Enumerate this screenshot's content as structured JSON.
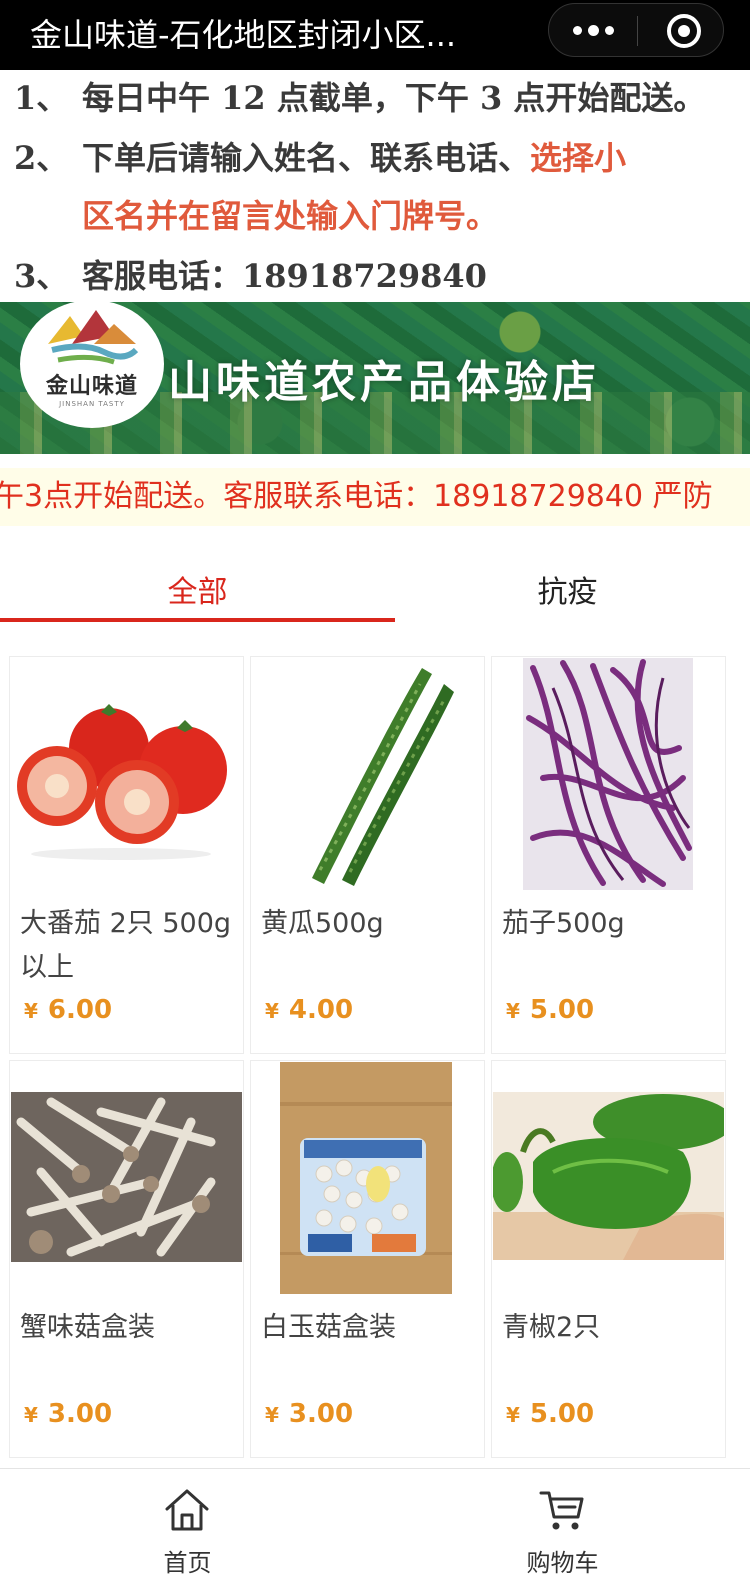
{
  "window": {
    "title": "金山味道-石化地区封闭小区..."
  },
  "notice": {
    "items": [
      {
        "num": "1、",
        "text": "每日中午 12 点截单，下午 3 点开始配送。"
      },
      {
        "num": "2、",
        "text_a": "下单后请输入姓名、联系电话、",
        "text_b": "选择小",
        "text_c": "区名并在留言处输入门牌号。"
      },
      {
        "num": "3、",
        "text": "客服电话：18918729840"
      }
    ]
  },
  "banner": {
    "shop_name": "山味道农产品体验店",
    "logo_text": "金山味道",
    "logo_en": "JINSHAN TASTY"
  },
  "marquee": {
    "text": "午3点开始配送。客服联系电话：18918729840 严防"
  },
  "tabs": [
    {
      "label": "全部",
      "active": true
    },
    {
      "label": "抗疫",
      "active": false
    }
  ],
  "currency": "¥",
  "products": [
    {
      "name": "大番茄 2只 500g以上",
      "price": "6.00",
      "image": "tomato"
    },
    {
      "name": "黄瓜500g",
      "price": "4.00",
      "image": "cucumber"
    },
    {
      "name": "茄子500g",
      "price": "5.00",
      "image": "eggplant"
    },
    {
      "name": "蟹味菇盒装",
      "price": "3.00",
      "image": "mushroom"
    },
    {
      "name": "白玉菇盒装",
      "price": "3.00",
      "image": "white-mushroom"
    },
    {
      "name": "青椒2只",
      "price": "5.00",
      "image": "green-pepper"
    }
  ],
  "bottom_nav": [
    {
      "label": "首页",
      "icon": "home-icon"
    },
    {
      "label": "购物车",
      "icon": "cart-icon"
    }
  ],
  "colors": {
    "accent": "#d9261c",
    "price": "#e8901f",
    "notice_red": "#e05a3c"
  }
}
